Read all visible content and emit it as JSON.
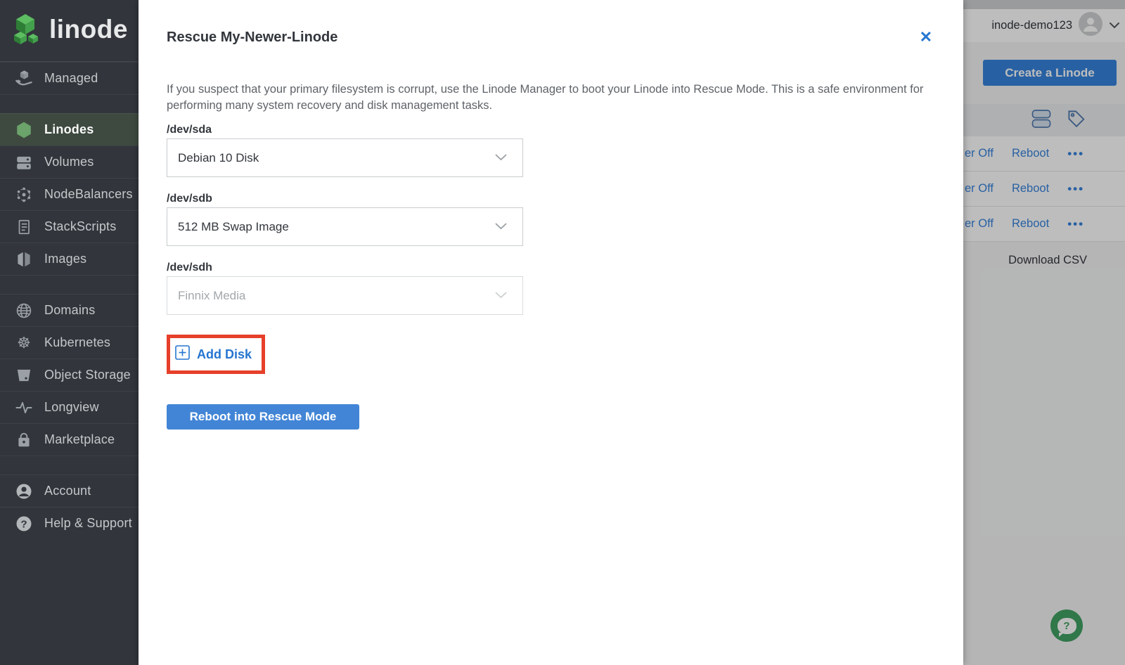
{
  "brand": {
    "wordmark": "linode"
  },
  "colors": {
    "accent_blue": "#3683DC",
    "link_blue": "#2575D0",
    "active_green": "#6BA36A",
    "annotation_red": "#E6402A",
    "beacon_green": "#41A163",
    "sidebar_bg": "#32363C"
  },
  "sidebar": {
    "items": [
      {
        "label": "Managed"
      },
      {
        "label": "Linodes",
        "active": true
      },
      {
        "label": "Volumes"
      },
      {
        "label": "NodeBalancers"
      },
      {
        "label": "StackScripts"
      },
      {
        "label": "Images"
      },
      {
        "label": "Domains"
      },
      {
        "label": "Kubernetes"
      },
      {
        "label": "Object Storage"
      },
      {
        "label": "Longview"
      },
      {
        "label": "Marketplace"
      },
      {
        "label": "Account"
      },
      {
        "label": "Help & Support"
      }
    ]
  },
  "topbar": {
    "username": "inode-demo123"
  },
  "content": {
    "create_button_label": "Create a Linode",
    "rows": [
      {
        "power_label": "er Off",
        "reboot_label": "Reboot",
        "more_label": "•••"
      },
      {
        "power_label": "er Off",
        "reboot_label": "Reboot",
        "more_label": "•••"
      },
      {
        "power_label": "er Off",
        "reboot_label": "Reboot",
        "more_label": "•••"
      }
    ],
    "download_csv_label": "Download CSV"
  },
  "modal": {
    "title": "Rescue My-Newer-Linode",
    "close_label": "✕",
    "description": "If you suspect that your primary filesystem is corrupt, use the Linode Manager to boot your Linode into Rescue Mode. This is a safe environment for performing many system recovery and disk management tasks.",
    "fields": [
      {
        "label": "/dev/sda",
        "value": "Debian 10 Disk"
      },
      {
        "label": "/dev/sdb",
        "value": "512 MB Swap Image"
      },
      {
        "label": "/dev/sdh",
        "value": "Finnix Media"
      }
    ],
    "add_disk_label": "Add Disk",
    "submit_label": "Reboot into Rescue Mode"
  },
  "icons": {
    "kubernetes_glyph": "☸",
    "help_glyph": "?"
  }
}
